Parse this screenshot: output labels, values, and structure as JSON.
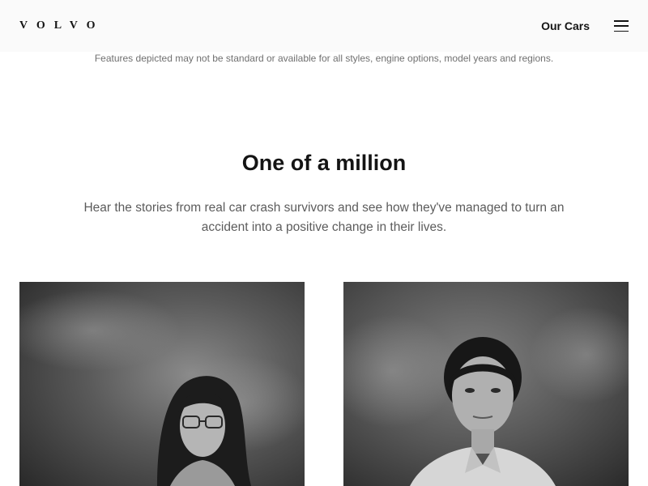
{
  "header": {
    "logo_text": "VOLVO",
    "nav_link": "Our Cars"
  },
  "disclaimer": "Features depicted may not be standard or available for all styles, engine options, model years and regions.",
  "section": {
    "title": "One of a million",
    "description": "Hear the stories from real car crash survivors and see how they've managed to turn an accident into a positive change in their lives."
  },
  "cards": [
    {
      "label": "portrait of a woman with glasses"
    },
    {
      "label": "portrait of a woman with hair tied back"
    }
  ],
  "colors": {
    "header_bg": "#fafafa",
    "text_primary": "#141414",
    "text_secondary": "#5c5c5c"
  },
  "icons": {
    "menu": "hamburger-menu-icon"
  }
}
